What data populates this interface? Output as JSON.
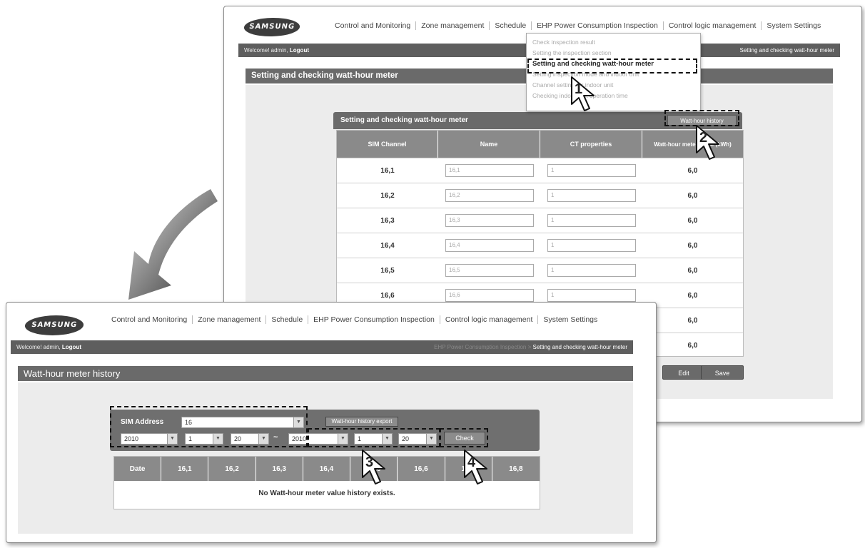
{
  "nav": {
    "menu": [
      "Control and Monitoring",
      "Zone management",
      "Schedule",
      "EHP Power Consumption Inspection",
      "Control logic management",
      "System Settings"
    ]
  },
  "back_window": {
    "logo": "SAMSUNG",
    "welcome_prefix": "Welcome! admin,",
    "welcome_user": "Logout",
    "breadcrumb": "Setting and checking watt-hour meter",
    "section_title": "Setting and checking watt-hour meter",
    "dropdown_items": [
      "Check inspection result",
      "Setting the inspection section",
      "Setting and checking watt-hour meter",
      "Setting inspection mode and indoor unit",
      "Channel setting for indoor unit",
      "Checking indoor unit operation time"
    ],
    "panel_title": "Setting and checking watt-hour meter",
    "history_button": "Watt-hour history",
    "table_headers": [
      "SIM Channel",
      "Name",
      "CT properties",
      "Watt-hour meter value (kWh)"
    ],
    "rows": [
      {
        "channel": "16,1",
        "name": "16,1",
        "ct": "1",
        "value": "6,0"
      },
      {
        "channel": "16,2",
        "name": "16,2",
        "ct": "1",
        "value": "6,0"
      },
      {
        "channel": "16,3",
        "name": "16,3",
        "ct": "1",
        "value": "6,0"
      },
      {
        "channel": "16,4",
        "name": "16,4",
        "ct": "1",
        "value": "6,0"
      },
      {
        "channel": "16,5",
        "name": "16,5",
        "ct": "1",
        "value": "6,0"
      },
      {
        "channel": "16,6",
        "name": "16,6",
        "ct": "1",
        "value": "6,0"
      },
      {
        "channel": "",
        "name": "",
        "ct": "",
        "value": "6,0"
      },
      {
        "channel": "",
        "name": "",
        "ct": "",
        "value": "6,0"
      }
    ],
    "edit_button": "Edit",
    "save_button": "Save"
  },
  "front_window": {
    "logo": "SAMSUNG",
    "welcome_prefix": "Welcome! admin,",
    "welcome_user": "Logout",
    "breadcrumb_faded": "EHP Power Consumption Inspection >",
    "breadcrumb": "Setting and checking watt-hour meter",
    "section_title": "Watt-hour meter history",
    "sim_label": "SIM Address",
    "sim_value": "16",
    "export_button": "Watt-hour history export",
    "from_year": "2010",
    "from_month": "1",
    "from_day": "20",
    "range_sep": "~",
    "to_year": "2010",
    "to_month": "1",
    "to_day": "20",
    "check_button": "Check",
    "table_headers": [
      "Date",
      "16,1",
      "16,2",
      "16,3",
      "16,4",
      "16,5",
      "16,6",
      "16,7",
      "16,8"
    ],
    "empty_message": "No Watt-hour meter value history exists."
  },
  "steps": [
    "1",
    "2",
    "3",
    "4"
  ]
}
